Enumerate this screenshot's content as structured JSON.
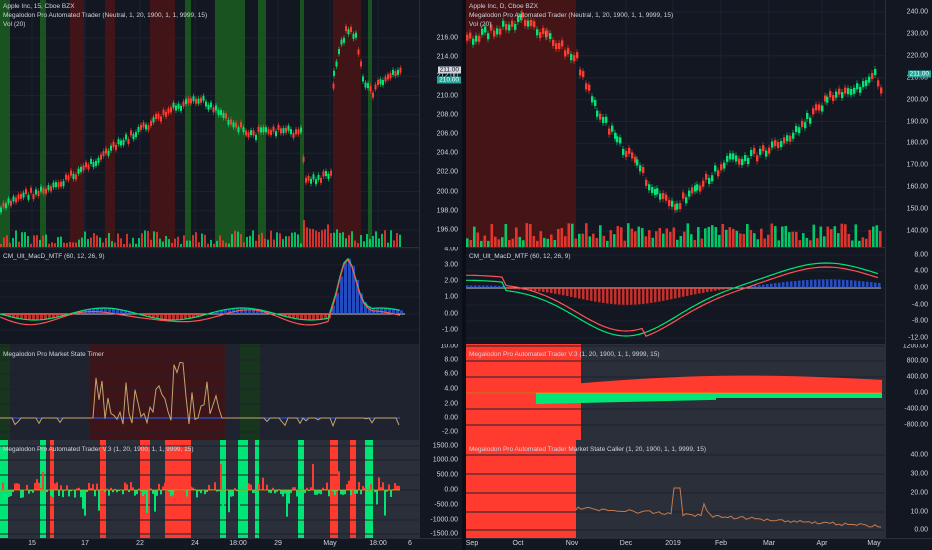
{
  "left_chart": {
    "symbol_line": "Apple Inc, 15, Cboe BZX",
    "indicator_line": "Megalodon Pro Automated Trader (Neutral, 1, 20, 1900, 1, 1, 9999, 15)",
    "vol_line": "Vol (20)",
    "price_ticks": [
      "216.00",
      "214.00",
      "212.00",
      "210.00",
      "208.00",
      "206.00",
      "204.00",
      "202.00",
      "200.00",
      "198.00",
      "196.00"
    ],
    "price_tag_1": "211.00",
    "price_tag_2": "210.00",
    "macd_title": "CM_Ult_MacD_MTF (60, 12, 26, 9)",
    "macd_ticks": [
      "4.00",
      "3.00",
      "2.00",
      "1.00",
      "0.00",
      "-1.00"
    ],
    "timer_title": "Megalodon Pro Market State Timer",
    "timer_ticks": [
      "10.00",
      "8.00",
      "6.00",
      "4.00",
      "2.00",
      "0.00",
      "-2.00"
    ],
    "trader_title": "Megalodon Pro Automated Trader V.3 (1, 20, 1900, 1, 1, 9999, 15)",
    "trader_ticks": [
      "1500.00",
      "1000.00",
      "500.00",
      "0.00",
      "-500.00",
      "-1000.00",
      "-1500.00"
    ],
    "x_labels": [
      "15",
      "17",
      "22",
      "24",
      "18:00",
      "29",
      "May",
      "18:00",
      "6"
    ]
  },
  "right_chart": {
    "symbol_line": "Apple Inc, D, Cboe BZX",
    "indicator_line": "Megalodon Pro Automated Trader (Neutral, 1, 20, 1900, 1, 1, 9999, 15)",
    "vol_line": "Vol (20)",
    "price_ticks": [
      "240.00",
      "230.00",
      "220.00",
      "210.00",
      "200.00",
      "190.00",
      "180.00",
      "170.00",
      "160.00",
      "150.00",
      "140.00"
    ],
    "price_tag_1": "211.00",
    "macd_title": "CM_Ult_MacD_MTF (60, 12, 26, 9)",
    "macd_ticks": [
      "8.00",
      "4.00",
      "0.00",
      "-4.00",
      "-8.00",
      "-12.00"
    ],
    "trader_title": "Megalodon Pro Automated Trader V.3 (1, 20, 1900, 1, 1, 9999, 15)",
    "trader_ticks": [
      "1200.00",
      "800.00",
      "400.00",
      "0.00",
      "-400.00",
      "-800.00"
    ],
    "caller_title": "Megalodon Pro Automated Trader Market State Caller (1, 20, 1900, 1, 1, 9999, 15)",
    "caller_ticks": [
      "40.00",
      "30.00",
      "20.00",
      "10.00",
      "0.00"
    ],
    "x_labels": [
      "Sep",
      "Oct",
      "Nov",
      "Dec",
      "2019",
      "Feb",
      "Mar",
      "Apr",
      "May"
    ]
  },
  "colors": {
    "bull": "#26a69a",
    "up": "#00e676",
    "down": "#ff3b30",
    "bg": "#131722",
    "grid": "#1e222d",
    "fast": "#00e676",
    "slow": "#ff5252",
    "timer": "#c8a36a",
    "blue": "#2962ff"
  }
}
